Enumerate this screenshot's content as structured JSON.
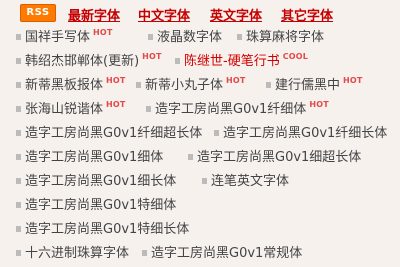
{
  "header": {
    "rss": "RSS",
    "nav": [
      "最新字体",
      "中文字体",
      "英文字体",
      "其它字体"
    ]
  },
  "list": [
    [
      {
        "text": "国祥手写体",
        "tag": "HOT"
      },
      {
        "text": "液晶数字体"
      },
      {
        "text": "珠算麻将字体"
      }
    ],
    [
      {
        "text": "韩绍杰邯郸体(更新)",
        "tag": "HOT"
      },
      {
        "text": "陈继世-硬笔行书",
        "tag": "COOL",
        "style": "red"
      }
    ],
    [
      {
        "text": "新蒂黑板报体",
        "tag": "HOT"
      },
      {
        "text": "新蒂小丸子体",
        "tag": "HOT"
      },
      {
        "text": "建行儒黑中",
        "tag": "HOT"
      }
    ],
    [
      {
        "text": "张海山锐谐体",
        "tag": "HOT"
      },
      {
        "text": "造字工房尚黑G0v1纤细体",
        "tag": "HOT"
      }
    ],
    [
      {
        "text": "造字工房尚黑G0v1纤细超长体"
      },
      {
        "text": "造字工房尚黑G0v1纤细长体"
      }
    ],
    [
      {
        "text": "造字工房尚黑G0v1细体"
      },
      {
        "text": "造字工房尚黑G0v1细超长体"
      }
    ],
    [
      {
        "text": "造字工房尚黑G0v1细长体"
      },
      {
        "text": "连笔英文字体"
      }
    ],
    [
      {
        "text": "造字工房尚黑G0v1特细体"
      }
    ],
    [
      {
        "text": "造字工房尚黑G0v1特细长体"
      }
    ],
    [
      {
        "text": "十六进制珠算字体"
      },
      {
        "text": "造字工房尚黑G0v1常规体"
      }
    ]
  ]
}
